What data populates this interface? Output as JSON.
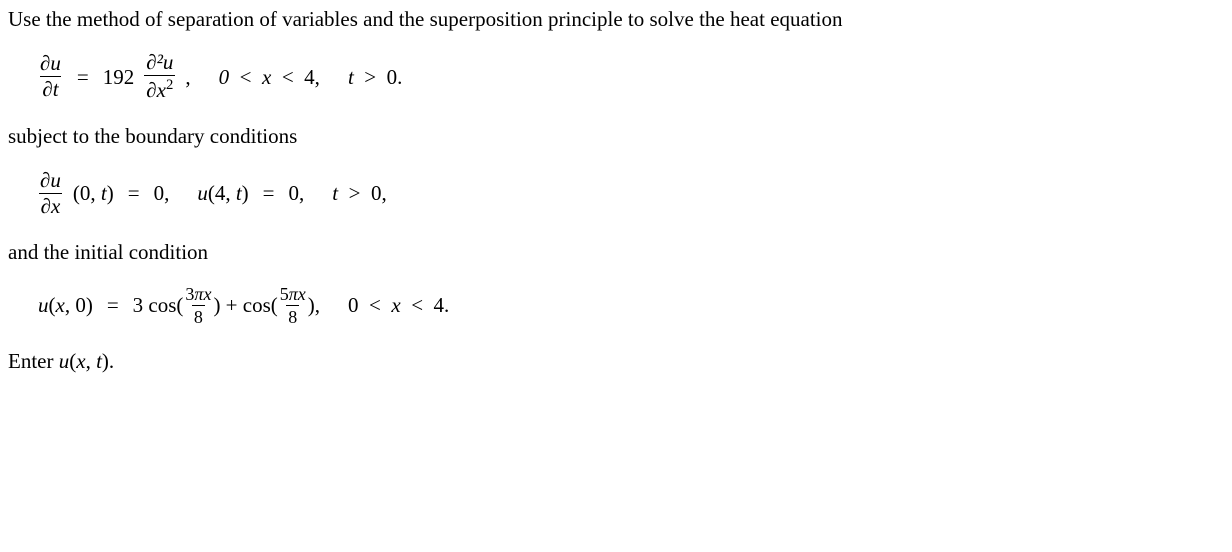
{
  "chart_data": {
    "type": "math_problem",
    "pde": "u_t = 192 u_xx",
    "domain": "0 < x < 4, t > 0",
    "bc": [
      "u_x(0,t)=0",
      "u(4,t)=0"
    ],
    "ic": "u(x,0) = 3 cos(3πx/8) + cos(5πx/8)"
  },
  "intro": "Use the method of separation of variables and the superposition principle to solve the heat equation",
  "eq1": {
    "lhs_num": "∂u",
    "lhs_den": "∂t",
    "equals": "=",
    "coef": "192",
    "rhs_num": "∂²u",
    "rhs_den": "∂x²",
    "comma": ",",
    "domain1": "0  <  x  <  4,",
    "domain2": "t  >  0."
  },
  "bc_intro": "subject to the boundary conditions",
  "bc": {
    "l1_num": "∂u",
    "l1_den": "∂x",
    "l1_args": "(0, t)",
    "eq": "=",
    "zero1": "0,",
    "u": "u",
    "l2_args": "(4, t)",
    "zero2": "0,",
    "tcond": "t  >  0,"
  },
  "ic_intro": "and the initial condition",
  "ic": {
    "u": "u",
    "args": "(x, 0)",
    "eq": "=",
    "c1": "3 cos(",
    "f1_num": "3πx",
    "f1_den": "8",
    "mid": ") + cos(",
    "f2_num": "5πx",
    "f2_den": "8",
    "end": "),",
    "domain": "0  <  x  <  4."
  },
  "prompt_pre": "Enter ",
  "prompt_u": "u",
  "prompt_args": "(x, t).",
  "sup2": "2"
}
